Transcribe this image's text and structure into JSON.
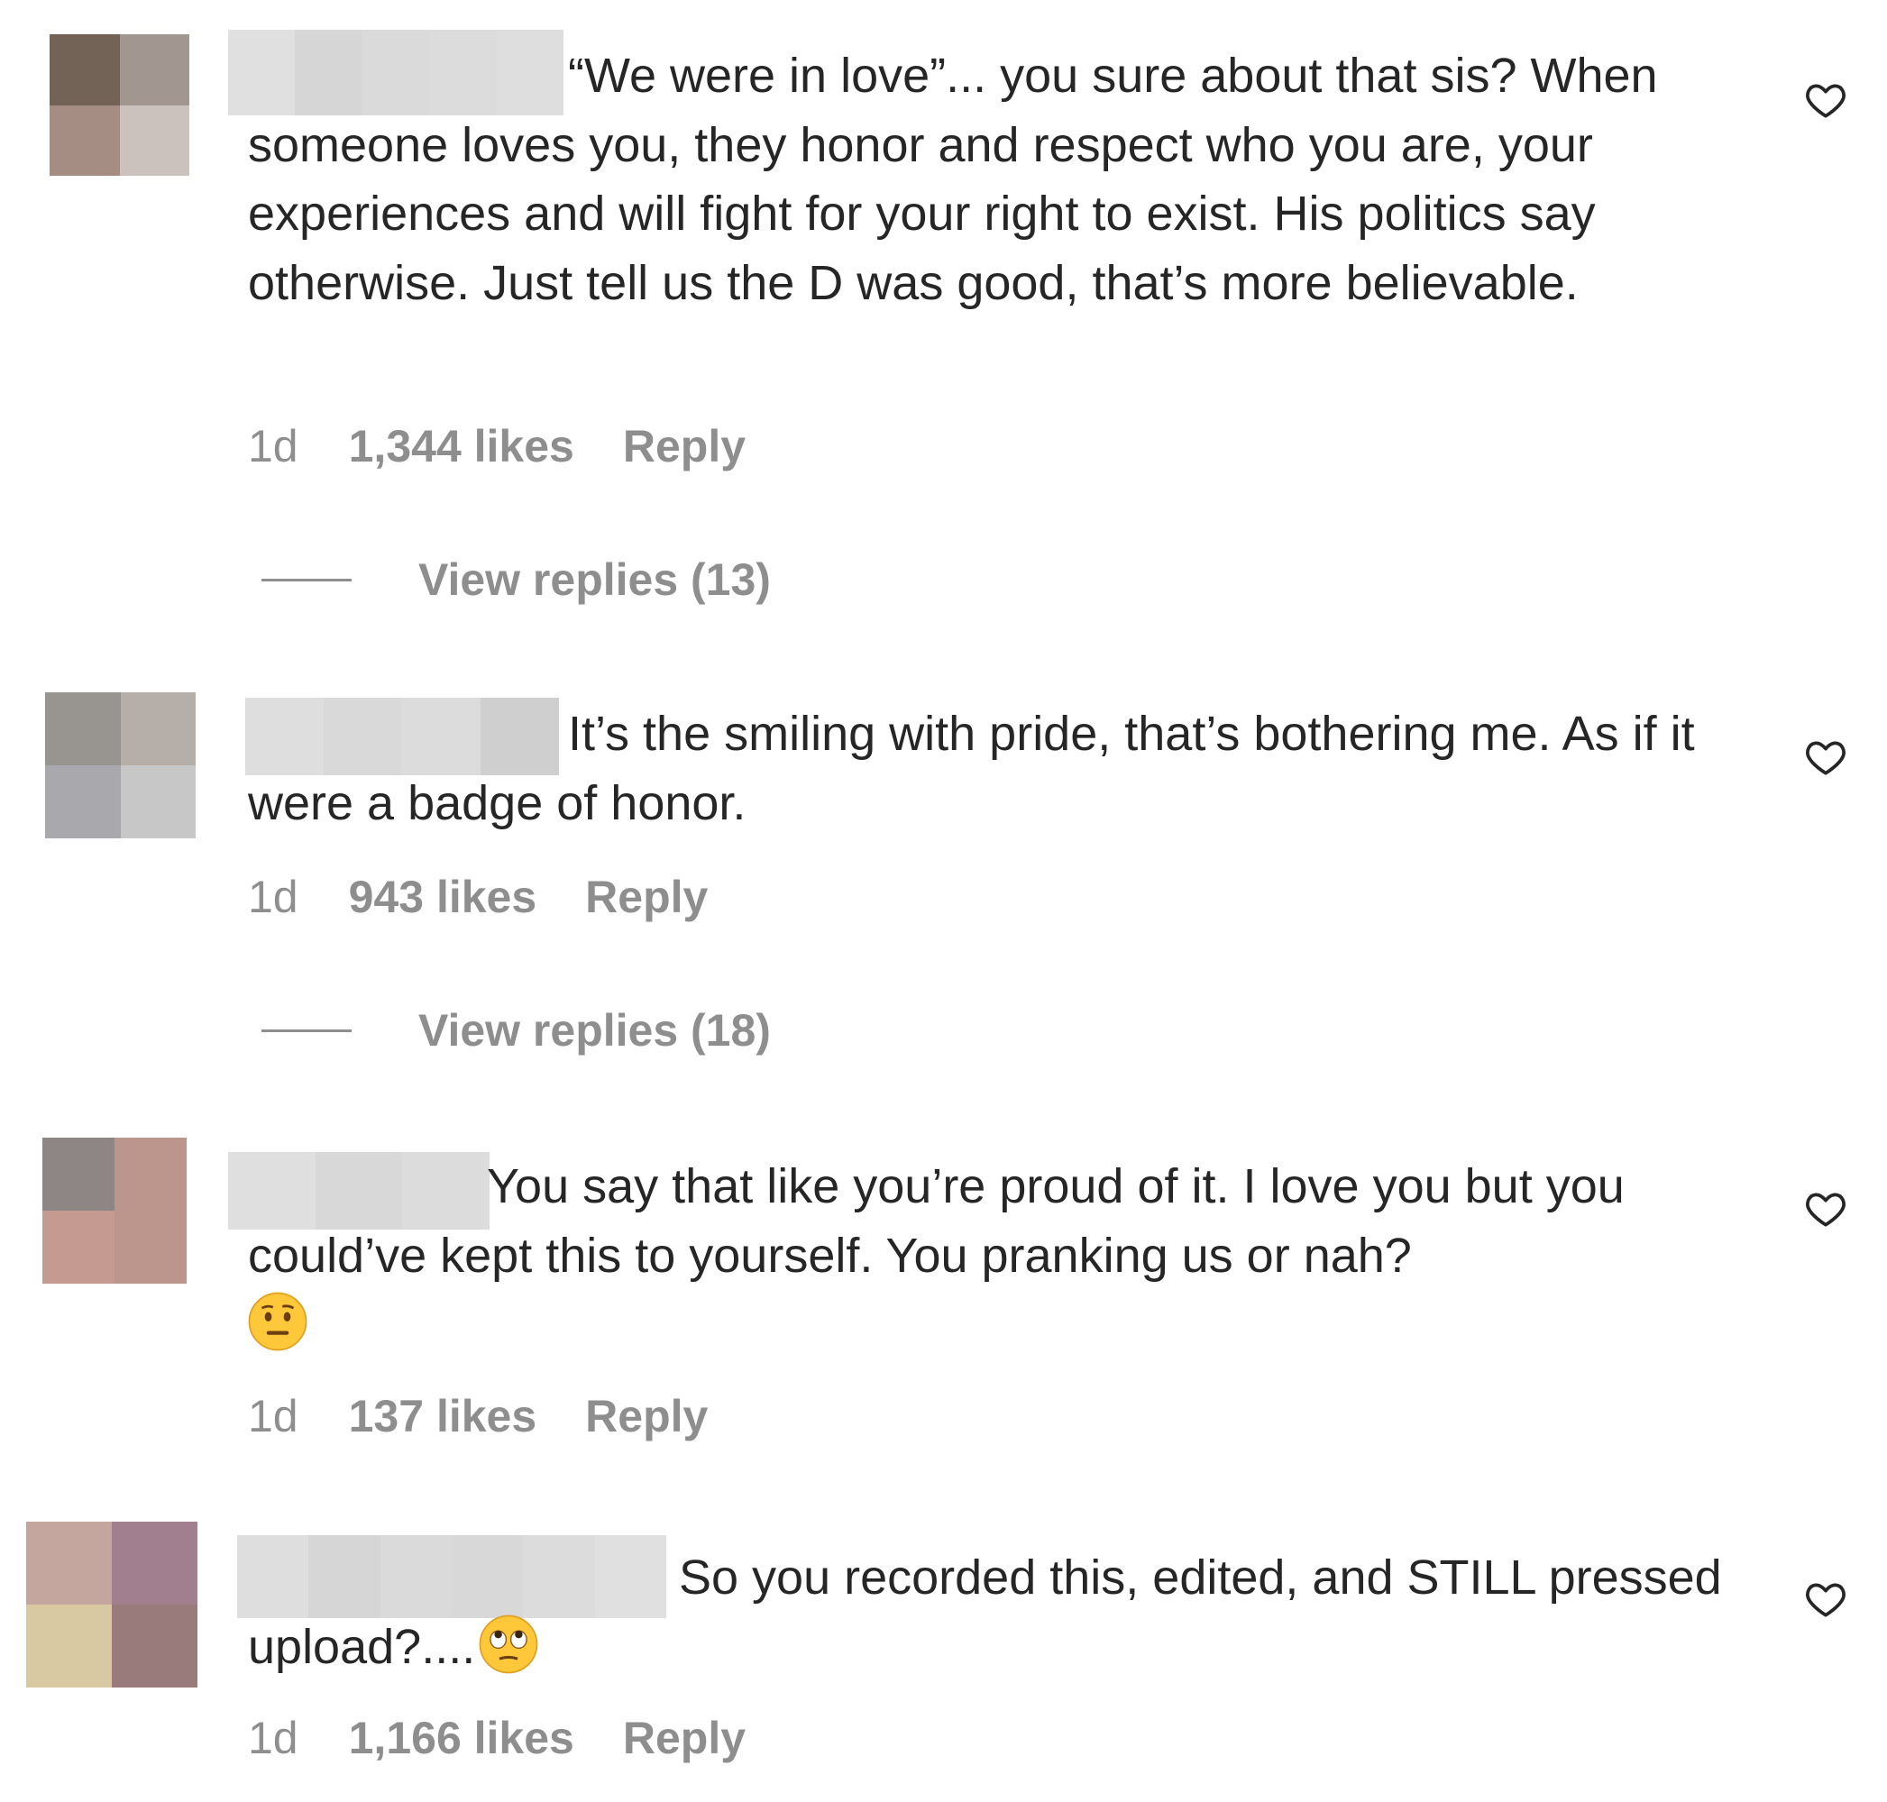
{
  "comments": [
    {
      "text": "“We were in love”... you sure about that sis? When someone loves you, they honor and respect who you are, your experiences and will fight for your right to exist. His politics say otherwise. Just tell us the D was good, that’s more believable.",
      "time": "1d",
      "likes": "1,344 likes",
      "reply": "Reply",
      "view_replies": "View replies (13)"
    },
    {
      "text": "It’s the smiling with pride, that’s bothering me. As if it were a badge of honor.",
      "time": "1d",
      "likes": "943 likes",
      "reply": "Reply",
      "view_replies": "View replies (18)"
    },
    {
      "text": "You say that like you’re proud of it. I love you but you could’ve kept this to yourself. You pranking us or nah?",
      "emoji": "neutral-face-emoji",
      "time": "1d",
      "likes": "137 likes",
      "reply": "Reply"
    },
    {
      "text": "So you recorded this, edited, and STILL pressed upload?....",
      "emoji": "eye-roll-emoji",
      "time": "1d",
      "likes": "1,166 likes",
      "reply": "Reply"
    }
  ],
  "colors": {
    "text": "#262626",
    "secondary": "#8e8e8e",
    "redaction": "#dadada"
  },
  "icons": {
    "like": "heart-outline-icon"
  }
}
